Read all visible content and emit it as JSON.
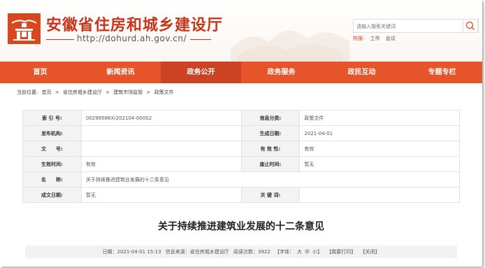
{
  "header": {
    "title": "安徽省住房和城乡建设厅",
    "url": "http://dohurd.ah.gov.cn/",
    "search_placeholder": "请输入搜索关键词",
    "hot_label": "热搜:",
    "hot_words": [
      "工作",
      "会议"
    ]
  },
  "nav": {
    "items": [
      "首页",
      "新闻资讯",
      "政务公开",
      "政务服务",
      "政民互动",
      "专题专栏"
    ],
    "active_index": 2
  },
  "breadcrumb": {
    "prefix": "当前位置:",
    "items": [
      "首页",
      ">",
      "省住房城乡建设厅",
      ">",
      "建筑市场监管",
      ">",
      "政策文件"
    ]
  },
  "info": {
    "rows": [
      {
        "l1": "索 引 号:",
        "v1": "00298586X/202104-00002",
        "l2": "信息分类:",
        "v2": "政策文件"
      },
      {
        "l1": "发布机构:",
        "v1": "",
        "l2": "生成日期:",
        "v2": "2021-04-01"
      },
      {
        "l1": "文　　号:",
        "v1": "",
        "l2": "有 效 性:",
        "v2": "有效"
      },
      {
        "l1": "生效时间:",
        "v1": "有效",
        "l2": "废止时间:",
        "v2": "暂无"
      },
      {
        "l1": "名　　称:",
        "v1": "关于持续推进建筑业发展的十二条意见",
        "l2": "",
        "v2": ""
      },
      {
        "l1": "成文日期:",
        "v1": "暂无",
        "l2": "关 键 词:",
        "v2": ""
      }
    ]
  },
  "article": {
    "title": "关于持续推进建筑业发展的十二条意见"
  },
  "meta": {
    "date": "日期：2021-04-01 15:13",
    "source": "信息来源：省住房城乡建设厅",
    "views": "阅读次数：3922",
    "font_label": "【字体：",
    "font_big": "大",
    "font_mid": "中",
    "font_small": "小】",
    "print": "【我要打印】",
    "close": "【关闭】"
  }
}
